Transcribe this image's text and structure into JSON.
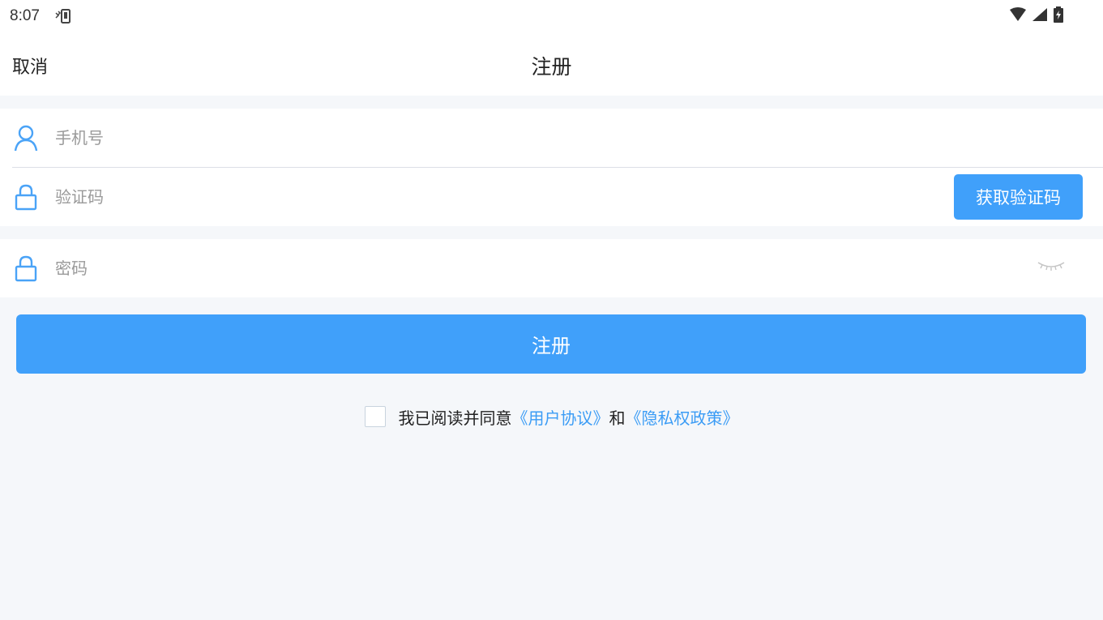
{
  "status_bar": {
    "time": "8:07",
    "icons": [
      "vibrate-phone-icon",
      "wifi-icon",
      "signal-icon",
      "battery-charging-icon"
    ]
  },
  "header": {
    "cancel_label": "取消",
    "title": "注册"
  },
  "form": {
    "phone": {
      "placeholder": "手机号",
      "value": "",
      "icon": "user-icon"
    },
    "code": {
      "placeholder": "验证码",
      "value": "",
      "icon": "lock-icon",
      "button_label": "获取验证码"
    },
    "password": {
      "placeholder": "密码",
      "value": "",
      "icon": "lock-icon",
      "toggle_icon": "eye-closed-icon"
    }
  },
  "register_button_label": "注册",
  "agreement": {
    "checked": false,
    "prefix": "我已阅读并同意",
    "user_agreement_link": "《用户协议》",
    "conjunction": "和",
    "privacy_policy_link": "《隐私权政策》"
  },
  "colors": {
    "accent": "#40a0fa",
    "link": "#3b9cf5",
    "background": "#f5f7fa",
    "icon_blue": "#4aa3f7"
  }
}
